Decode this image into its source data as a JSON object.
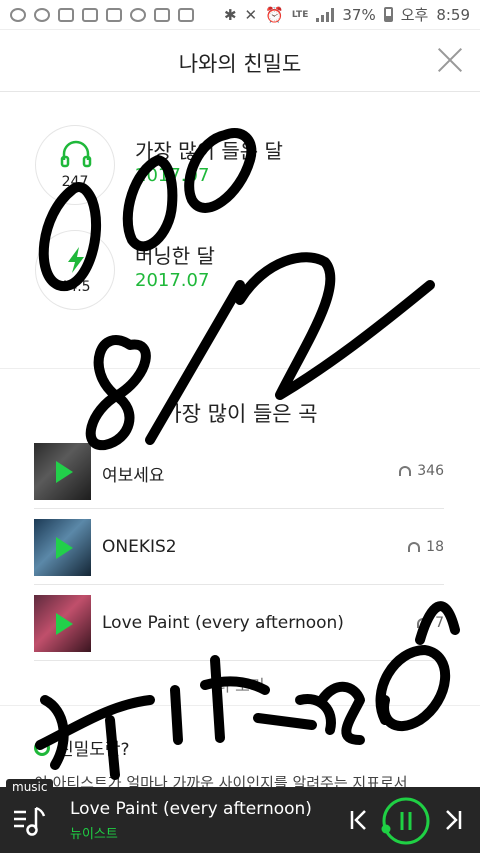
{
  "status_bar": {
    "lte": "LTE",
    "battery": "37%",
    "period": "오후",
    "time": "8:59"
  },
  "header": {
    "title": "나와의 친밀도"
  },
  "stats": [
    {
      "number": "247",
      "label": "가장 많이 들은 달",
      "value": "2017.07"
    },
    {
      "number": "44.5",
      "label": "버닝한 달",
      "value": "2017.07"
    }
  ],
  "top_songs": {
    "title": "가장 많이 들은 곡",
    "songs": [
      {
        "name": "여보세요",
        "count": "346"
      },
      {
        "name": "ONEKIS2",
        "count": "18"
      },
      {
        "name": "Love Paint (every afternoon)",
        "count": "7"
      }
    ],
    "more_label": "더 보기"
  },
  "help": {
    "title": "친밀도란?",
    "description": "이 아티스트가 얼마나 가까운 사이인지를 알려주는 지표로서"
  },
  "player": {
    "badge": "music",
    "title": "Love Paint (every afternoon)",
    "artist": "뉴이스트"
  },
  "colors": {
    "accent": "#1fb83a",
    "player_bg": "#262626"
  }
}
